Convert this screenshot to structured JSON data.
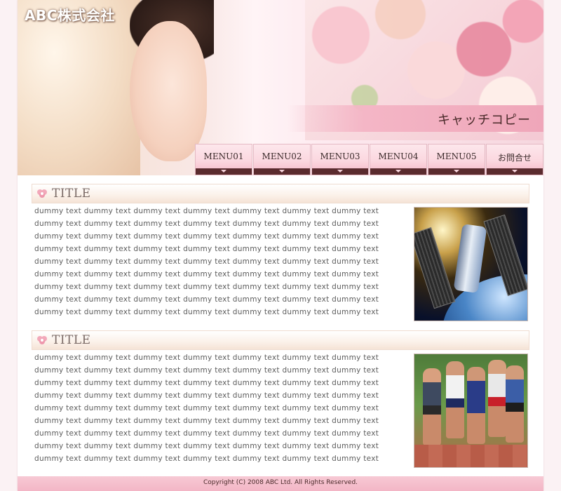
{
  "header": {
    "company_name": "ABC株式会社",
    "catch_copy": "キャッチコピー"
  },
  "nav": {
    "items": [
      {
        "label": "MENU01"
      },
      {
        "label": "MENU02"
      },
      {
        "label": "MENU03"
      },
      {
        "label": "MENU04"
      },
      {
        "label": "MENU05"
      },
      {
        "label": "お問合せ"
      }
    ]
  },
  "sections": [
    {
      "title": "TITLE",
      "lines": [
        "dummy text dummy text dummy text dummy text dummy text dummy text dummy text",
        "dummy text dummy text dummy text dummy text dummy text dummy text dummy text",
        "dummy text dummy text dummy text dummy text dummy text dummy text dummy text",
        "dummy text dummy text dummy text dummy text dummy text dummy text dummy text",
        "dummy text dummy text dummy text dummy text dummy text dummy text dummy text",
        "dummy text dummy text dummy text dummy text dummy text dummy text dummy text",
        "dummy text dummy text dummy text dummy text dummy text dummy text dummy text",
        "dummy text dummy text dummy text dummy text dummy text dummy text dummy text",
        "dummy text dummy text dummy text dummy text dummy text dummy text dummy text"
      ],
      "image": "space-telescope-photo"
    },
    {
      "title": "TITLE",
      "lines": [
        "dummy text dummy text dummy text dummy text dummy text dummy text dummy text",
        "dummy text dummy text dummy text dummy text dummy text dummy text dummy text",
        "dummy text dummy text dummy text dummy text dummy text dummy text dummy text",
        "dummy text dummy text dummy text dummy text dummy text dummy text dummy text",
        "dummy text dummy text dummy text dummy text dummy text dummy text dummy text",
        "dummy text dummy text dummy text dummy text dummy text dummy text dummy text",
        "dummy text dummy text dummy text dummy text dummy text dummy text dummy text",
        "dummy text dummy text dummy text dummy text dummy text dummy text dummy text",
        "dummy text dummy text dummy text dummy text dummy text dummy text dummy text"
      ],
      "image": "sprinters-photo"
    }
  ],
  "footer": {
    "copyright": "Copyright (C) 2008 ABC Ltd. All Rights Reserved."
  },
  "colors": {
    "accent_pink": "#f4b6c6",
    "nav_dark_bar": "#5a2b2e",
    "title_text": "#7a6a66"
  }
}
